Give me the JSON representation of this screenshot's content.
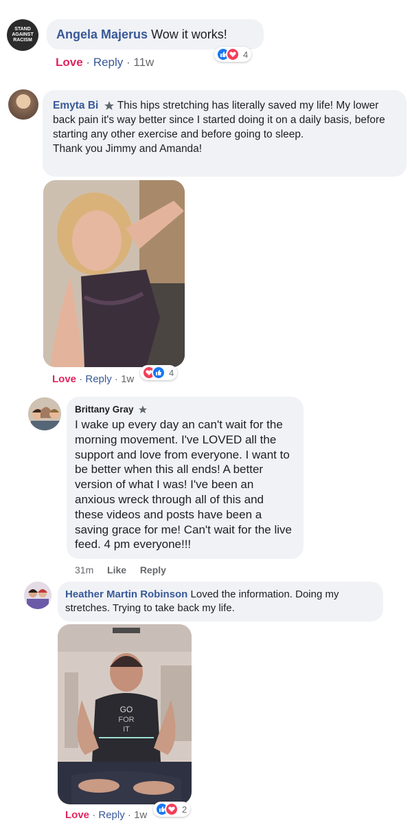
{
  "comments": [
    {
      "name": "Angela Majerus",
      "text": "Wow it works!",
      "avatar_text": "STAND AGAINST RACISM",
      "actions": {
        "love": "Love",
        "reply": "Reply",
        "time": "11w"
      },
      "reaction_count": "4"
    },
    {
      "name": "Emyta Bi",
      "badge_icon": "top-fan-star-icon",
      "text": "This hips stretching has literally saved my life! My lower back pain it's way better since I started doing it on a daily basis, before starting any other exercise and before going to sleep.",
      "text2": "Thank you Jimmy and Amanda!",
      "actions": {
        "love": "Love",
        "reply": "Reply",
        "time": "1w"
      },
      "reaction_count": "4"
    },
    {
      "name": "Brittany Gray",
      "badge_icon": "top-fan-star-icon",
      "text": "I wake up every day an can't wait for the morning movement. I've LOVED all the support and love from everyone. I want to be better when this all ends! A better version of what I was! I've been an anxious wreck through all of this and these videos and posts have been a saving grace for me! Can't wait for the live feed. 4 pm everyone!!!",
      "actions": {
        "time": "31m",
        "like": "Like",
        "reply": "Reply"
      }
    },
    {
      "name": "Heather Martin Robinson",
      "text": "Loved the information. Doing my stretches. Trying to take back my life.",
      "shirt_text": "GO FOR IT",
      "actions": {
        "love": "Love",
        "reply": "Reply",
        "time": "1w"
      },
      "reaction_count": "2"
    }
  ],
  "colors": {
    "name": "#385898",
    "love": "#e0245e",
    "like": "#1877f2",
    "heart": "#f33e58",
    "bubble": "#f0f2f5"
  }
}
